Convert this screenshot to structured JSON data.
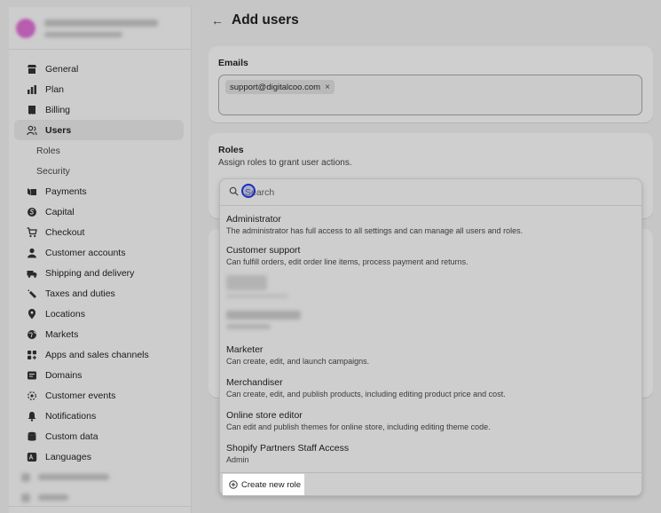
{
  "page": {
    "title": "Add users"
  },
  "store": {
    "name_blurred": true
  },
  "sidebar": {
    "items": [
      {
        "label": "General",
        "icon": "store-icon"
      },
      {
        "label": "Plan",
        "icon": "chart-icon"
      },
      {
        "label": "Billing",
        "icon": "receipt-icon"
      },
      {
        "label": "Users",
        "icon": "users-icon",
        "active": true
      },
      {
        "label": "Roles",
        "sub": true
      },
      {
        "label": "Security",
        "sub": true
      },
      {
        "label": "Payments",
        "icon": "payment-icon"
      },
      {
        "label": "Capital",
        "icon": "capital-icon"
      },
      {
        "label": "Checkout",
        "icon": "cart-icon"
      },
      {
        "label": "Customer accounts",
        "icon": "person-icon"
      },
      {
        "label": "Shipping and delivery",
        "icon": "truck-icon"
      },
      {
        "label": "Taxes and duties",
        "icon": "tax-icon"
      },
      {
        "label": "Locations",
        "icon": "location-icon"
      },
      {
        "label": "Markets",
        "icon": "globe-icon"
      },
      {
        "label": "Apps and sales channels",
        "icon": "apps-icon"
      },
      {
        "label": "Domains",
        "icon": "domain-icon"
      },
      {
        "label": "Customer events",
        "icon": "events-icon"
      },
      {
        "label": "Notifications",
        "icon": "bell-icon"
      },
      {
        "label": "Custom data",
        "icon": "database-icon"
      },
      {
        "label": "Languages",
        "icon": "language-icon"
      }
    ]
  },
  "emails": {
    "label": "Emails",
    "chips": [
      "support@digitalcoo.com"
    ]
  },
  "roles": {
    "label": "Roles",
    "description": "Assign roles to grant user actions.",
    "search_placeholder": "Search",
    "items": [
      {
        "name": "Administrator",
        "desc": "The administrator has full access to all settings and can manage all users and roles."
      },
      {
        "name": "Customer support",
        "desc": "Can fulfill orders, edit order line items, process payment and returns."
      },
      {
        "name": "Marketer",
        "desc": "Can create, edit, and launch campaigns."
      },
      {
        "name": "Merchandiser",
        "desc": "Can create, edit, and publish products, including editing product price and cost."
      },
      {
        "name": "Online store editor",
        "desc": "Can edit and publish themes for online store, including editing theme code."
      },
      {
        "name": "Shopify Partners Staff Access",
        "desc": "Admin"
      }
    ],
    "create_label": "Create new role"
  }
}
